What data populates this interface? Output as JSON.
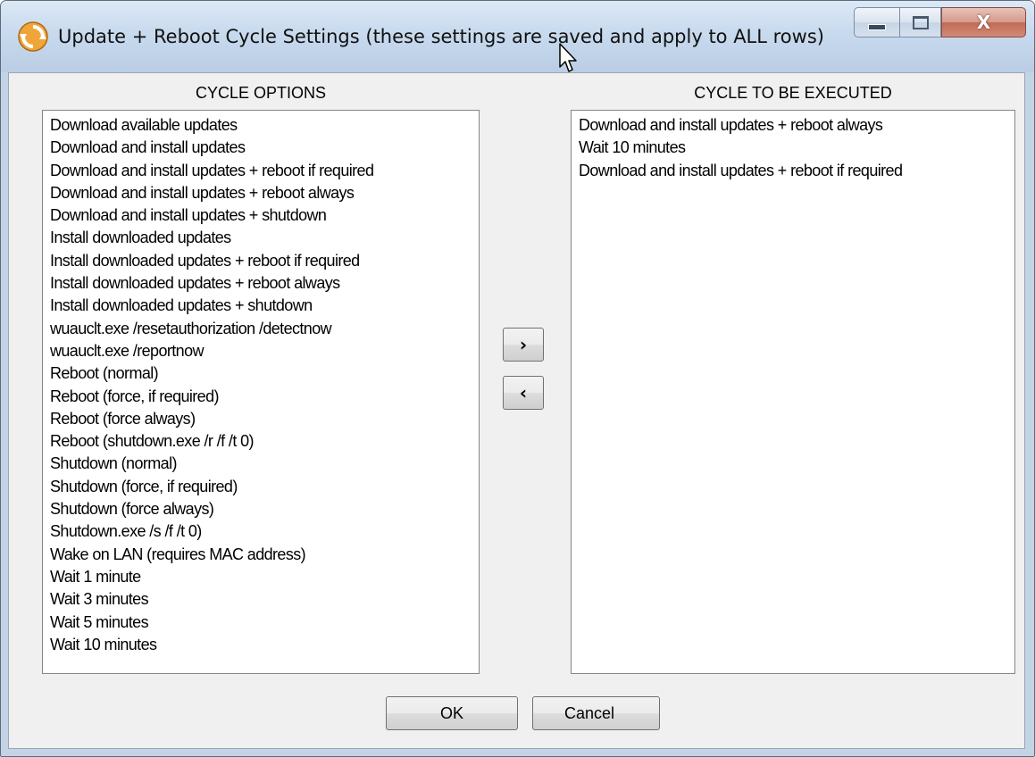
{
  "window": {
    "title": "Update + Reboot Cycle Settings  (these settings are saved and apply to ALL rows)",
    "close_glyph": "X"
  },
  "left_panel": {
    "label": "CYCLE OPTIONS",
    "items": [
      "Download available updates",
      "Download and install updates",
      "Download and install updates + reboot if required",
      "Download and install updates + reboot always",
      "Download and install updates + shutdown",
      "Install downloaded updates",
      "Install downloaded updates + reboot if required",
      "Install downloaded updates + reboot always",
      "Install downloaded updates + shutdown",
      "wuauclt.exe /resetauthorization /detectnow",
      "wuauclt.exe /reportnow",
      "Reboot (normal)",
      "Reboot (force, if required)",
      "Reboot (force always)",
      "Reboot (shutdown.exe /r /f /t 0)",
      "Shutdown (normal)",
      "Shutdown (force, if required)",
      "Shutdown (force always)",
      "Shutdown.exe /s /f /t 0)",
      "Wake on LAN (requires MAC address)",
      "Wait 1 minute",
      "Wait 3 minutes",
      "Wait 5 minutes",
      "Wait 10 minutes"
    ]
  },
  "right_panel": {
    "label": "CYCLE TO BE EXECUTED",
    "items": [
      "Download and install updates + reboot always",
      "Wait 10 minutes",
      "Download and install updates + reboot if required"
    ]
  },
  "transfer": {
    "add_label": "›",
    "remove_label": "‹"
  },
  "footer": {
    "ok_label": "OK",
    "cancel_label": "Cancel"
  },
  "icons": {
    "app": "refresh-cycle-icon",
    "minimize": "minimize-icon",
    "maximize": "maximize-icon",
    "close": "close-icon",
    "cursor": "mouse-pointer-icon"
  },
  "colors": {
    "title_bar": "#c8daee",
    "close_button": "#c46a56",
    "app_icon": "#e8901c"
  }
}
